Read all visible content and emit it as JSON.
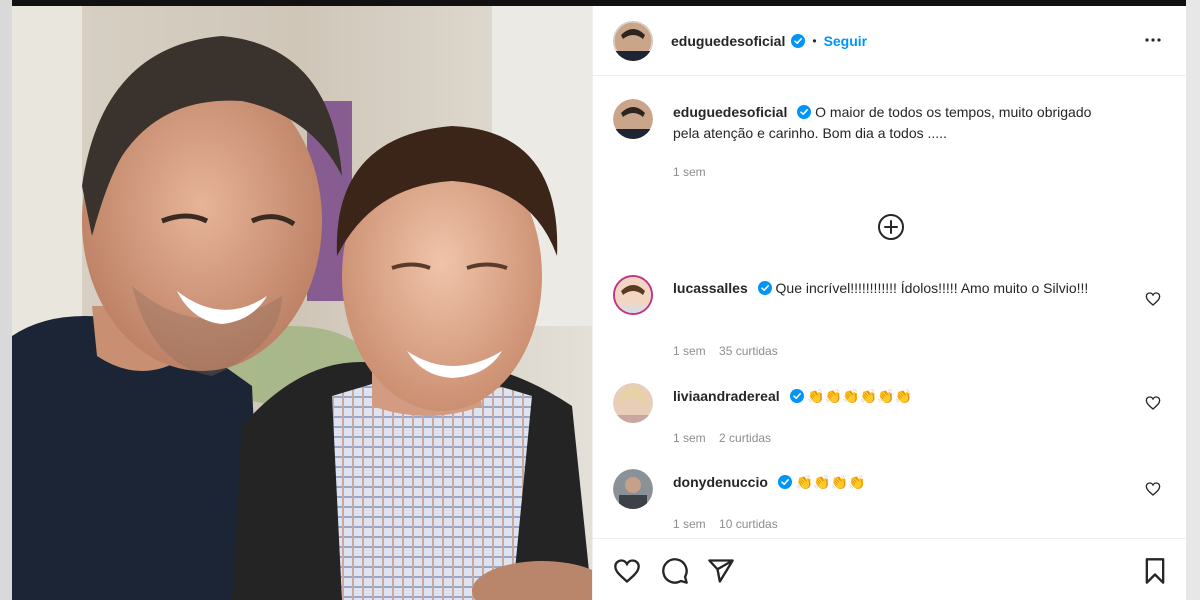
{
  "post": {
    "author": "eduguedesoficial",
    "follow_label": "Seguir",
    "separator": "•",
    "caption": "O maior de todos os tempos, muito obrigado pela atenção e carinho. Bom dia a todos .....",
    "caption_time": "1 sem"
  },
  "comments": [
    {
      "user": "lucassalles",
      "text": "Que incrível!!!!!!!!!!!! Ídolos!!!!! Amo muito o Silvio!!!",
      "time": "1 sem",
      "likes": "35 curtidas"
    },
    {
      "user": "liviaandradereal",
      "text": "👏👏👏👏👏👏",
      "time": "1 sem",
      "likes": "2 curtidas"
    },
    {
      "user": "donydenuccio",
      "text": "👏👏👏👏",
      "time": "1 sem",
      "likes": "10 curtidas"
    }
  ],
  "icons": {
    "verified": "verified-badge-icon",
    "more": "more-options-icon",
    "add": "load-more-comments-icon",
    "heart": "heart-icon",
    "comment": "comment-icon",
    "share": "share-icon",
    "save": "bookmark-icon"
  },
  "colors": {
    "accent": "#0095f6",
    "text": "#262626",
    "muted": "#8e8e8e"
  }
}
